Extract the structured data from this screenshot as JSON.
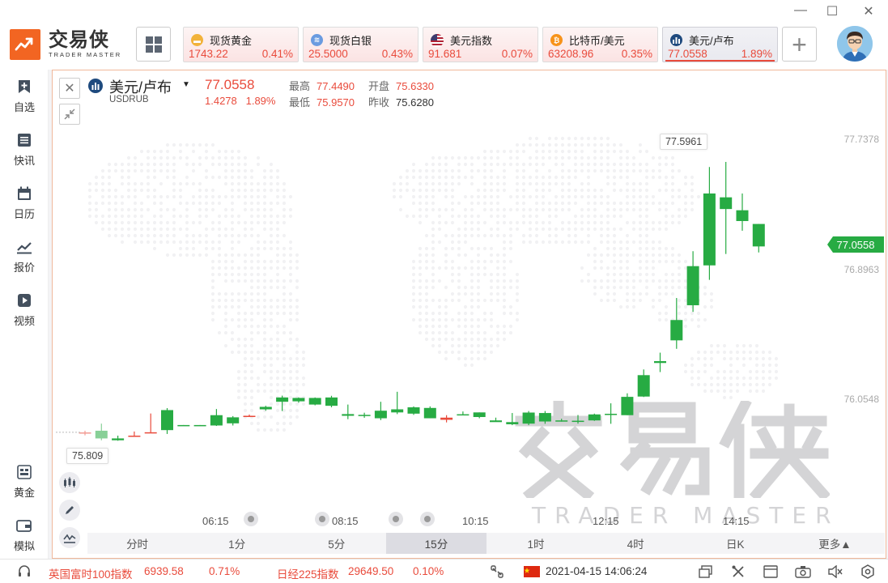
{
  "window": {
    "minimize": "—",
    "maximize": "☐",
    "close": "✕"
  },
  "logo": {
    "cn": "交易侠",
    "en": "TRADER MASTER"
  },
  "tickers": [
    {
      "name": "现货黄金",
      "price": "1743.22",
      "change": "0.41%",
      "icon_color": "#f2b23a",
      "icon": "gold-icon"
    },
    {
      "name": "现货白银",
      "price": "25.5000",
      "change": "0.43%",
      "icon_color": "#6a9be0",
      "icon": "silver-icon"
    },
    {
      "name": "美元指数",
      "price": "91.681",
      "change": "0.07%",
      "icon_color": "#b22234",
      "icon": "us-flag-icon"
    },
    {
      "name": "比特币/美元",
      "price": "63208.96",
      "change": "0.35%",
      "icon_color": "#f7931a",
      "icon": "bitcoin-icon"
    },
    {
      "name": "美元/卢布",
      "price": "77.0558",
      "change": "1.89%",
      "icon_color": "#1e4a7e",
      "icon": "chart-bars-icon"
    }
  ],
  "plus_label": "+",
  "sidebar": [
    {
      "label": "自选",
      "icon": "bookmark-plus-icon"
    },
    {
      "label": "快讯",
      "icon": "news-list-icon"
    },
    {
      "label": "日历",
      "icon": "calendar-icon"
    },
    {
      "label": "报价",
      "icon": "trend-line-icon"
    },
    {
      "label": "视频",
      "icon": "play-icon"
    },
    {
      "label": "黄金",
      "icon": "gold-bar-icon"
    },
    {
      "label": "模拟",
      "icon": "wallet-icon"
    }
  ],
  "symbol": {
    "name": "美元/卢布",
    "caret": "▼",
    "code": "USDRUB",
    "price": "77.0558",
    "change_abs": "1.4278",
    "change_pct": "1.89%",
    "high_label": "最高",
    "high": "77.4490",
    "open_label": "开盘",
    "open": "75.6330",
    "low_label": "最低",
    "low": "75.9570",
    "prev_label": "昨收",
    "prev": "75.6280"
  },
  "chart_data": {
    "type": "candlestick",
    "y_axis_ticks": [
      "77.7378",
      "76.8963",
      "76.0548"
    ],
    "y_axis_values": [
      77.7378,
      76.8963,
      76.0548
    ],
    "x_axis_ticks": [
      "06:15",
      "08:15",
      "10:15",
      "12:15",
      "14:15"
    ],
    "current_price_label": "77.0558",
    "max_marker": "77.5961",
    "min_marker": "75.809",
    "candles": [
      {
        "o": 75.836,
        "h": 75.85,
        "l": 75.82,
        "c": 75.839
      },
      {
        "o": 75.85,
        "h": 75.896,
        "l": 75.788,
        "c": 75.8
      },
      {
        "o": 75.8,
        "h": 75.818,
        "l": 75.785,
        "c": 75.788
      },
      {
        "o": 75.818,
        "h": 75.845,
        "l": 75.81,
        "c": 75.818
      },
      {
        "o": 75.84,
        "h": 75.962,
        "l": 75.836,
        "c": 75.84
      },
      {
        "o": 75.984,
        "h": 75.997,
        "l": 75.829,
        "c": 75.854
      },
      {
        "o": 75.887,
        "h": 75.887,
        "l": 75.881,
        "c": 75.884
      },
      {
        "o": 75.887,
        "h": 75.887,
        "l": 75.881,
        "c": 75.884
      },
      {
        "o": 75.951,
        "h": 75.991,
        "l": 75.881,
        "c": 75.884
      },
      {
        "o": 75.937,
        "h": 75.945,
        "l": 75.884,
        "c": 75.898
      },
      {
        "o": 75.947,
        "h": 75.955,
        "l": 75.942,
        "c": 75.947
      },
      {
        "o": 76.005,
        "h": 76.012,
        "l": 75.98,
        "c": 75.989
      },
      {
        "o": 76.066,
        "h": 76.078,
        "l": 75.978,
        "c": 76.038
      },
      {
        "o": 76.063,
        "h": 76.066,
        "l": 76.032,
        "c": 76.041
      },
      {
        "o": 76.063,
        "h": 76.066,
        "l": 76.015,
        "c": 76.02
      },
      {
        "o": 76.066,
        "h": 76.077,
        "l": 76.002,
        "c": 76.012
      },
      {
        "o": 75.958,
        "h": 76.02,
        "l": 75.925,
        "c": 75.947
      },
      {
        "o": 75.953,
        "h": 75.967,
        "l": 75.934,
        "c": 75.947
      },
      {
        "o": 75.98,
        "h": 76.038,
        "l": 75.919,
        "c": 75.931
      },
      {
        "o": 75.989,
        "h": 76.103,
        "l": 75.958,
        "c": 75.969
      },
      {
        "o": 76.002,
        "h": 76.008,
        "l": 75.953,
        "c": 75.961
      },
      {
        "o": 75.998,
        "h": 76.008,
        "l": 75.931,
        "c": 75.931
      },
      {
        "o": 75.921,
        "h": 75.951,
        "l": 75.904,
        "c": 75.935
      },
      {
        "o": 75.957,
        "h": 75.975,
        "l": 75.95,
        "c": 75.953
      },
      {
        "o": 75.969,
        "h": 75.969,
        "l": 75.931,
        "c": 75.939
      },
      {
        "o": 75.917,
        "h": 75.935,
        "l": 75.909,
        "c": 75.906
      },
      {
        "o": 75.906,
        "h": 75.965,
        "l": 75.886,
        "c": 75.892
      },
      {
        "o": 75.968,
        "h": 75.978,
        "l": 75.886,
        "c": 75.896
      },
      {
        "o": 75.965,
        "h": 75.978,
        "l": 75.895,
        "c": 75.91
      },
      {
        "o": 75.917,
        "h": 75.928,
        "l": 75.909,
        "c": 75.911
      },
      {
        "o": 75.915,
        "h": 75.952,
        "l": 75.896,
        "c": 75.913
      },
      {
        "o": 75.956,
        "h": 75.961,
        "l": 75.914,
        "c": 75.917
      },
      {
        "o": 75.96,
        "h": 76.028,
        "l": 75.895,
        "c": 75.953
      },
      {
        "o": 76.07,
        "h": 76.093,
        "l": 75.951,
        "c": 75.951
      },
      {
        "o": 76.211,
        "h": 76.248,
        "l": 76.069,
        "c": 76.072
      },
      {
        "o": 76.302,
        "h": 76.357,
        "l": 76.231,
        "c": 76.29
      },
      {
        "o": 76.569,
        "h": 76.712,
        "l": 76.382,
        "c": 76.437
      },
      {
        "o": 76.919,
        "h": 77.016,
        "l": 76.622,
        "c": 76.665
      },
      {
        "o": 77.391,
        "h": 77.563,
        "l": 76.83,
        "c": 76.924
      },
      {
        "o": 77.366,
        "h": 77.596,
        "l": 76.998,
        "c": 77.29
      },
      {
        "o": 77.282,
        "h": 77.391,
        "l": 77.149,
        "c": 77.212
      },
      {
        "o": 77.193,
        "h": 77.193,
        "l": 77.008,
        "c": 77.047
      }
    ]
  },
  "periods": [
    "分时",
    "1分",
    "5分",
    "15分",
    "1时",
    "4时",
    "日K",
    "更多▲"
  ],
  "active_period": "15分",
  "watermark": {
    "cn": "交易侠",
    "en": "TRADER MASTER"
  },
  "statusbar": {
    "index1_name": "英国富时100指数",
    "index1_value": "6939.58",
    "index1_change": "0.71%",
    "index2_name": "日经225指数",
    "index2_value": "29649.50",
    "index2_change": "0.10%",
    "datetime": "2021-04-15 14:06:24"
  },
  "colors": {
    "up": "#e94b3c",
    "down": "#27ab43",
    "accent": "#f26522"
  }
}
